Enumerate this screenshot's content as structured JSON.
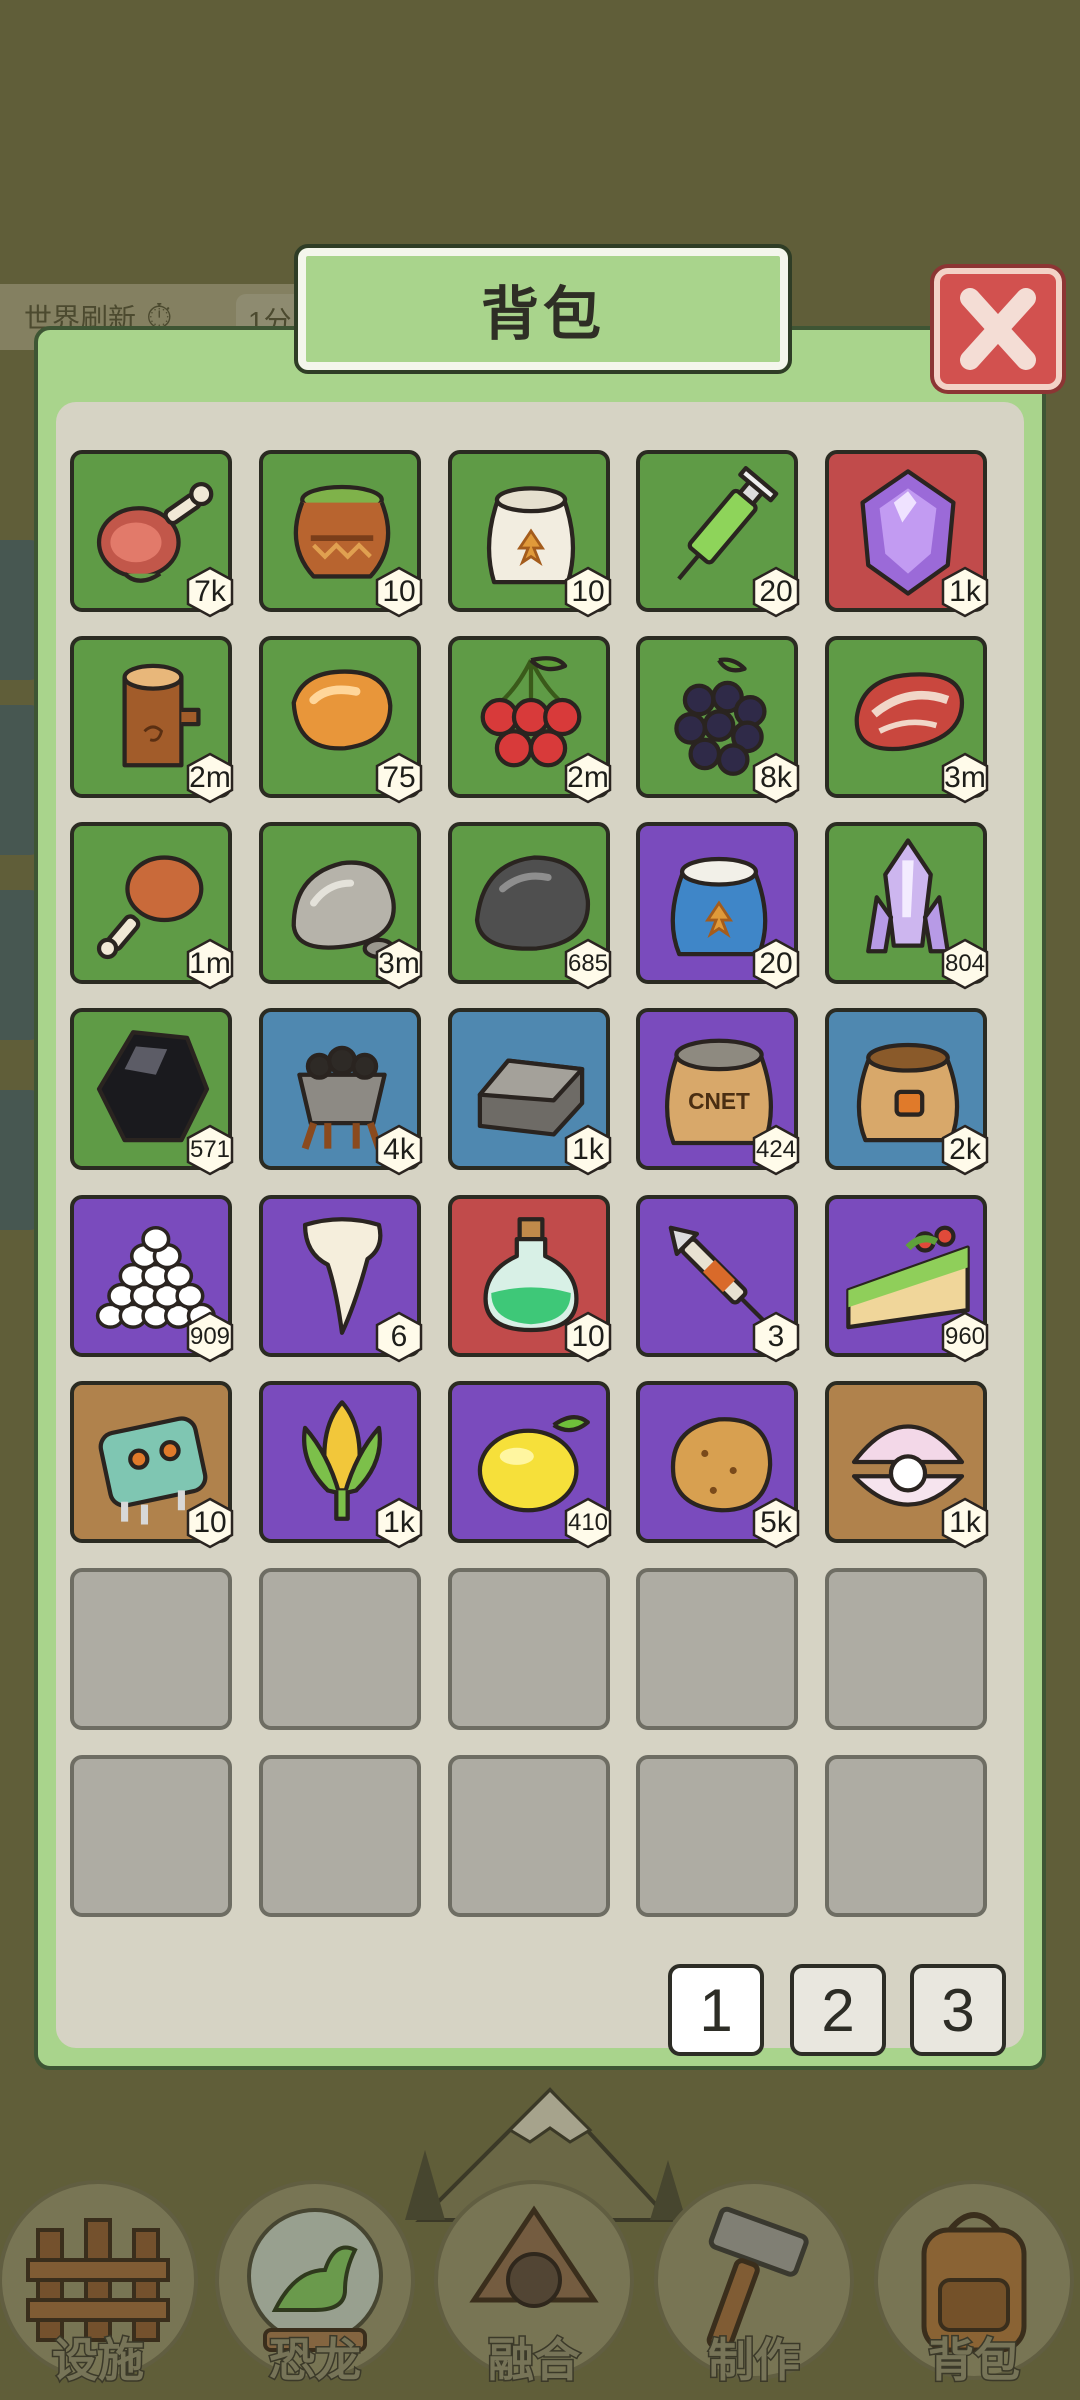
{
  "background": {
    "world_refresh_label": "世界刷新",
    "timer_icon": "stopwatch-icon",
    "countdown_prefix": "1分"
  },
  "panel": {
    "title": "背包",
    "close_icon": "close-icon"
  },
  "slots": [
    {
      "icon": "meat-leg-icon",
      "color": "green",
      "count": "7k"
    },
    {
      "icon": "clay-pot-icon",
      "color": "green",
      "count": "10"
    },
    {
      "icon": "flour-sack-icon",
      "color": "green",
      "count": "10"
    },
    {
      "icon": "green-syringe-icon",
      "color": "green",
      "count": "20"
    },
    {
      "icon": "purple-gem-icon",
      "color": "red",
      "count": "1k"
    },
    {
      "icon": "wood-log-icon",
      "color": "green",
      "count": "2m"
    },
    {
      "icon": "amber-icon",
      "color": "green",
      "count": "75"
    },
    {
      "icon": "berries-icon",
      "color": "green",
      "count": "2m"
    },
    {
      "icon": "blackberry-icon",
      "color": "green",
      "count": "8k"
    },
    {
      "icon": "steak-icon",
      "color": "green",
      "count": "3m"
    },
    {
      "icon": "drumstick-icon",
      "color": "green",
      "count": "1m"
    },
    {
      "icon": "stone-icon",
      "color": "green",
      "count": "3m"
    },
    {
      "icon": "dark-rock-icon",
      "color": "green",
      "count": "685"
    },
    {
      "icon": "blue-sack-icon",
      "color": "purple",
      "count": "20"
    },
    {
      "icon": "crystal-icon",
      "color": "green",
      "count": "804"
    },
    {
      "icon": "obsidian-icon",
      "color": "green",
      "count": "571"
    },
    {
      "icon": "coal-cart-icon",
      "color": "blue",
      "count": "4k"
    },
    {
      "icon": "iron-ingot-icon",
      "color": "blue",
      "count": "1k"
    },
    {
      "icon": "cnet-sack-icon",
      "color": "purple",
      "count": "424",
      "sack_text": "CNET"
    },
    {
      "icon": "seed-bag-icon",
      "color": "blue",
      "count": "2k"
    },
    {
      "icon": "eggs-pile-icon",
      "color": "purple",
      "count": "909"
    },
    {
      "icon": "tooth-icon",
      "color": "purple",
      "count": "6"
    },
    {
      "icon": "potion-icon",
      "color": "red",
      "count": "10"
    },
    {
      "icon": "dart-syringe-icon",
      "color": "purple",
      "count": "3"
    },
    {
      "icon": "sandwich-icon",
      "color": "purple",
      "count": "960"
    },
    {
      "icon": "circuit-chip-icon",
      "color": "brown",
      "count": "10"
    },
    {
      "icon": "corn-icon",
      "color": "purple",
      "count": "1k"
    },
    {
      "icon": "lemon-icon",
      "color": "purple",
      "count": "410"
    },
    {
      "icon": "potato-icon",
      "color": "purple",
      "count": "5k"
    },
    {
      "icon": "pearl-shell-icon",
      "color": "brown",
      "count": "1k"
    },
    {
      "icon": "",
      "color": "empty",
      "count": ""
    },
    {
      "icon": "",
      "color": "empty",
      "count": ""
    },
    {
      "icon": "",
      "color": "empty",
      "count": ""
    },
    {
      "icon": "",
      "color": "empty",
      "count": ""
    },
    {
      "icon": "",
      "color": "empty",
      "count": ""
    },
    {
      "icon": "",
      "color": "empty",
      "count": ""
    },
    {
      "icon": "",
      "color": "empty",
      "count": ""
    },
    {
      "icon": "",
      "color": "empty",
      "count": ""
    },
    {
      "icon": "",
      "color": "empty",
      "count": ""
    },
    {
      "icon": "",
      "color": "empty",
      "count": ""
    }
  ],
  "pager": {
    "pages": [
      "1",
      "2",
      "3"
    ],
    "current": "1"
  },
  "nav": [
    {
      "label": "设施",
      "icon": "fence-icon"
    },
    {
      "label": "恐龙",
      "icon": "dinosaur-globe-icon"
    },
    {
      "label": "融合",
      "icon": "fusion-icon"
    },
    {
      "label": "制作",
      "icon": "hammer-icon"
    },
    {
      "label": "背包",
      "icon": "backpack-icon"
    }
  ],
  "colors": {
    "green": "#5f9b46",
    "red": "#c14b4b",
    "purple": "#7a4bbd",
    "blue": "#4f88b0",
    "brown": "#b0824c",
    "panel": "#a9d48c",
    "panel_inner": "#d6d3c4"
  }
}
